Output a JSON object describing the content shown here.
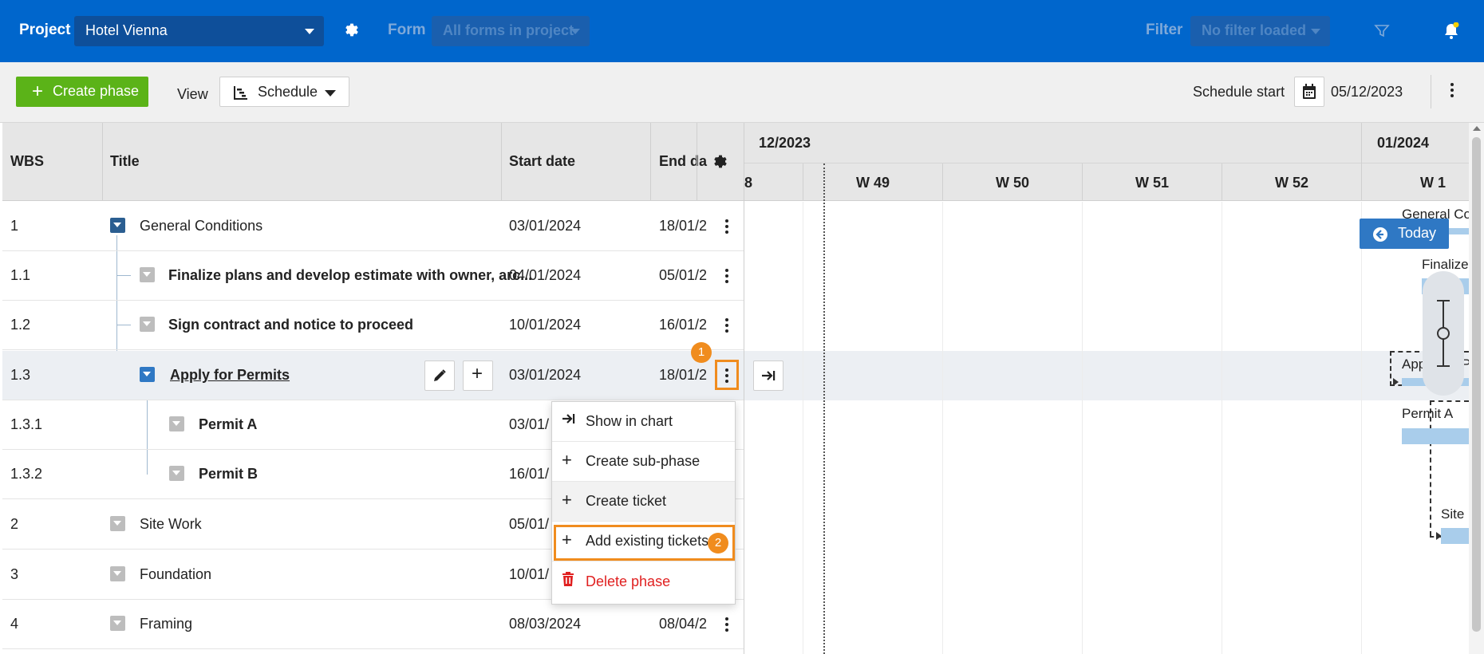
{
  "topbar": {
    "project_label": "Project",
    "project_value": "Hotel Vienna",
    "form_label": "Form",
    "form_value": "All forms in project",
    "filter_label": "Filter",
    "filter_value": "No filter loaded"
  },
  "toolbar": {
    "create_phase": "Create phase",
    "view_label": "View",
    "view_value": "Schedule",
    "schedule_start_label": "Schedule start",
    "schedule_start_value": "05/12/2023"
  },
  "grid": {
    "columns": [
      "WBS",
      "Title",
      "Start date",
      "End da"
    ],
    "rows": [
      {
        "wbs": "1",
        "title": "General Conditions",
        "start": "03/01/2024",
        "end": "18/01/2"
      },
      {
        "wbs": "1.1",
        "title": "Finalize plans and develop estimate with owner, arc...",
        "start": "04/01/2024",
        "end": "05/01/2"
      },
      {
        "wbs": "1.2",
        "title": "Sign contract and notice to proceed",
        "start": "10/01/2024",
        "end": "16/01/2"
      },
      {
        "wbs": "1.3",
        "title": "Apply for Permits",
        "start": "03/01/2024",
        "end": "18/01/2"
      },
      {
        "wbs": "1.3.1",
        "title": "Permit A",
        "start": "03/01/",
        "end": ""
      },
      {
        "wbs": "1.3.2",
        "title": "Permit B",
        "start": "16/01/",
        "end": ""
      },
      {
        "wbs": "2",
        "title": "Site Work",
        "start": "05/01/",
        "end": ""
      },
      {
        "wbs": "3",
        "title": "Foundation",
        "start": "10/01/",
        "end": ""
      },
      {
        "wbs": "4",
        "title": "Framing",
        "start": "08/03/2024",
        "end": "08/04/2"
      }
    ]
  },
  "timeline": {
    "months": [
      "12/2023",
      "01/2024"
    ],
    "weeks": [
      "8",
      "W 49",
      "W 50",
      "W 51",
      "W 52",
      "W 1"
    ],
    "today_label": "Today",
    "bar_labels": [
      "General Co",
      "Finalize",
      "App",
      "P",
      "Permit A",
      "Site"
    ]
  },
  "context_menu": {
    "items": [
      "Show in chart",
      "Create sub-phase",
      "Create ticket",
      "Add existing tickets",
      "Delete phase"
    ]
  },
  "markers": [
    "1",
    "2"
  ],
  "colors": {
    "brand": "#0066cc",
    "create": "#5bb318",
    "accent": "#f08c1e",
    "danger": "#e02020",
    "bar": "#a9cdeb"
  }
}
